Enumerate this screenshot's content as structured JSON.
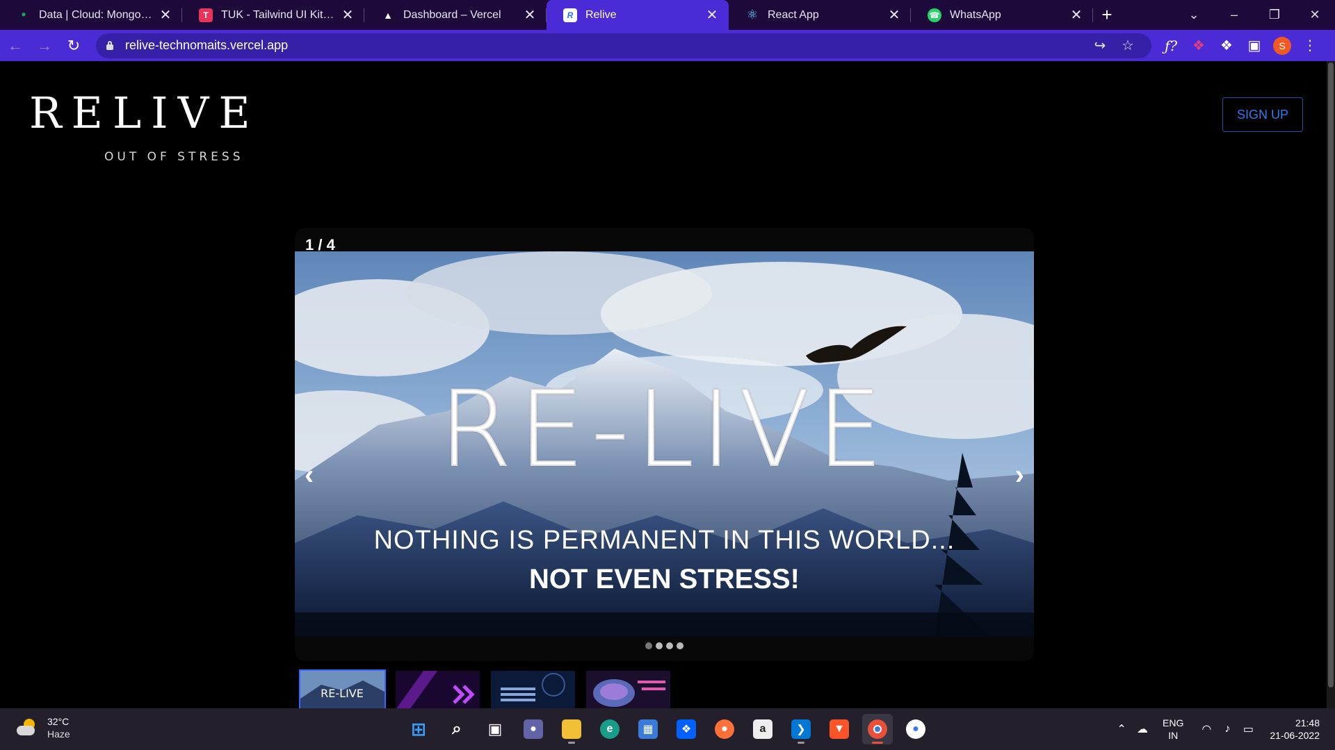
{
  "browser": {
    "tabs": [
      {
        "title": "Data | Cloud: MongoDB Clo",
        "favicon": "mongodb-leaf-icon",
        "color": "#13aa52",
        "glyph": "•",
        "active": false
      },
      {
        "title": "TUK - Tailwind UI Kit How to",
        "favicon": "tuk-icon",
        "color": "#e8335a",
        "glyph": "T",
        "active": false
      },
      {
        "title": "Dashboard – Vercel",
        "favicon": "vercel-triangle-icon",
        "color": "#000000",
        "glyph": "▲",
        "active": false
      },
      {
        "title": "Relive",
        "favicon": "react-icon",
        "color": "#2f6bff",
        "glyph": "R",
        "active": true
      },
      {
        "title": "React App",
        "favicon": "react-atom-icon",
        "color": "#1d0a3a",
        "glyph": "⚛",
        "active": false
      },
      {
        "title": "WhatsApp",
        "favicon": "whatsapp-icon",
        "color": "#25d366",
        "glyph": "☎",
        "active": false
      }
    ],
    "url": "relive-technomaits.vercel.app",
    "profile_initial": "S"
  },
  "page": {
    "logo": "RELIVE",
    "logo_tagline": "OUT OF STRESS",
    "signup_label": "SIGN UP",
    "carousel": {
      "counter": "1 / 4",
      "headline": "RE-LIVE",
      "tagline1": "NOTHING IS PERMANENT IN THIS WORLD...",
      "tagline2": "NOT EVEN STRESS!",
      "prev_label": "‹",
      "next_label": "›",
      "slide_count": 4,
      "active_index": 0
    },
    "thumbnails": [
      {
        "name": "thumb-relive",
        "active": true
      },
      {
        "name": "thumb-purple-chevrons",
        "active": false
      },
      {
        "name": "thumb-mental-health-priority",
        "active": false
      },
      {
        "name": "thumb-mental-health-matters",
        "active": false
      }
    ]
  },
  "taskbar": {
    "weather_temp": "32°C",
    "weather_cond": "Haze",
    "lang_top": "ENG",
    "lang_bottom": "IN",
    "time": "21:48",
    "date": "21-06-2022"
  }
}
